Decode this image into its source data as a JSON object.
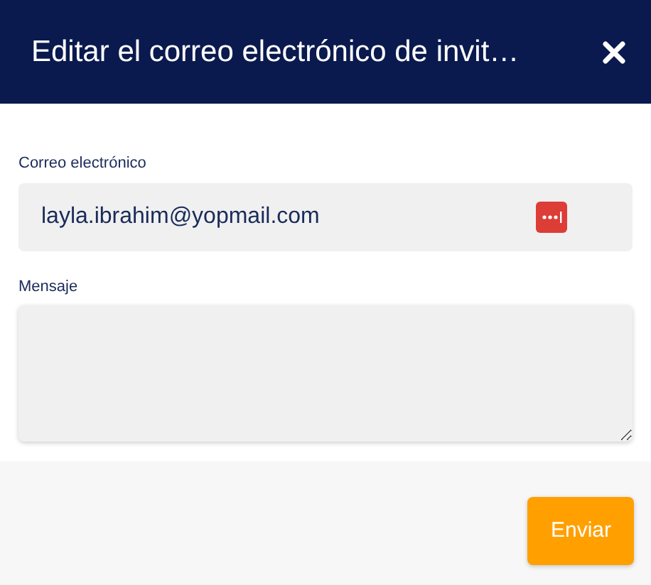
{
  "dialog": {
    "title": "Editar el correo electrónico de invit…"
  },
  "fields": [
    {
      "kind": "input",
      "label": "Correo electrónico",
      "value": "layla.ibrahim@yopmail.com"
    },
    {
      "kind": "textarea",
      "label": "Mensaje"
    }
  ],
  "buttons": [
    "Enviar"
  ]
}
